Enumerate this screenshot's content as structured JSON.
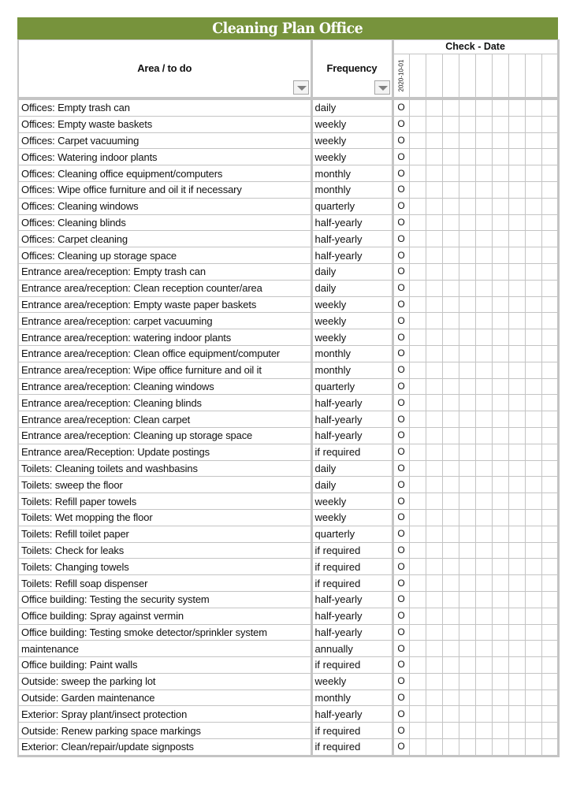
{
  "title": "Cleaning Plan Office",
  "headers": {
    "area": "Area / to do",
    "frequency": "Frequency",
    "check_group": "Check - Date",
    "check_dates": [
      "2020-10-01",
      "",
      "",
      "",
      "",
      "",
      "",
      "",
      "",
      ""
    ]
  },
  "filter_icon": "dropdown-arrow",
  "colors": {
    "title_bg": "#77933c",
    "title_text": "#ffffff",
    "grid": "#c4c4c4"
  },
  "check_mark": "O",
  "rows": [
    {
      "area": "Offices: Empty trash can",
      "frequency": "daily",
      "checks": [
        "O",
        "",
        "",
        "",
        "",
        "",
        "",
        "",
        "",
        ""
      ]
    },
    {
      "area": "Offices: Empty waste baskets",
      "frequency": "weekly",
      "checks": [
        "O",
        "",
        "",
        "",
        "",
        "",
        "",
        "",
        "",
        ""
      ]
    },
    {
      "area": "Offices: Carpet vacuuming",
      "frequency": "weekly",
      "checks": [
        "O",
        "",
        "",
        "",
        "",
        "",
        "",
        "",
        "",
        ""
      ]
    },
    {
      "area": "Offices: Watering indoor plants",
      "frequency": "weekly",
      "checks": [
        "O",
        "",
        "",
        "",
        "",
        "",
        "",
        "",
        "",
        ""
      ]
    },
    {
      "area": "Offices: Cleaning office equipment/computers",
      "frequency": "monthly",
      "checks": [
        "O",
        "",
        "",
        "",
        "",
        "",
        "",
        "",
        "",
        ""
      ]
    },
    {
      "area": "Offices: Wipe office furniture and oil it if necessary",
      "frequency": "monthly",
      "checks": [
        "O",
        "",
        "",
        "",
        "",
        "",
        "",
        "",
        "",
        ""
      ]
    },
    {
      "area": "Offices: Cleaning windows",
      "frequency": "quarterly",
      "checks": [
        "O",
        "",
        "",
        "",
        "",
        "",
        "",
        "",
        "",
        ""
      ]
    },
    {
      "area": "Offices: Cleaning blinds",
      "frequency": "half-yearly",
      "checks": [
        "O",
        "",
        "",
        "",
        "",
        "",
        "",
        "",
        "",
        ""
      ]
    },
    {
      "area": "Offices: Carpet cleaning",
      "frequency": "half-yearly",
      "checks": [
        "O",
        "",
        "",
        "",
        "",
        "",
        "",
        "",
        "",
        ""
      ]
    },
    {
      "area": "Offices: Cleaning up storage space",
      "frequency": "half-yearly",
      "checks": [
        "O",
        "",
        "",
        "",
        "",
        "",
        "",
        "",
        "",
        ""
      ]
    },
    {
      "area": "Entrance area/reception: Empty trash can",
      "frequency": "daily",
      "checks": [
        "O",
        "",
        "",
        "",
        "",
        "",
        "",
        "",
        "",
        ""
      ]
    },
    {
      "area": "Entrance area/reception: Clean reception counter/area",
      "frequency": "daily",
      "checks": [
        "O",
        "",
        "",
        "",
        "",
        "",
        "",
        "",
        "",
        ""
      ]
    },
    {
      "area": "Entrance area/reception: Empty waste paper baskets",
      "frequency": "weekly",
      "checks": [
        "O",
        "",
        "",
        "",
        "",
        "",
        "",
        "",
        "",
        ""
      ]
    },
    {
      "area": "Entrance area/reception: carpet vacuuming",
      "frequency": "weekly",
      "checks": [
        "O",
        "",
        "",
        "",
        "",
        "",
        "",
        "",
        "",
        ""
      ]
    },
    {
      "area": "Entrance area/reception: watering indoor plants",
      "frequency": "weekly",
      "checks": [
        "O",
        "",
        "",
        "",
        "",
        "",
        "",
        "",
        "",
        ""
      ]
    },
    {
      "area": "Entrance area/reception: Clean office equipment/computer",
      "frequency": "monthly",
      "checks": [
        "O",
        "",
        "",
        "",
        "",
        "",
        "",
        "",
        "",
        ""
      ]
    },
    {
      "area": "Entrance area/reception: Wipe office furniture and oil it",
      "frequency": "monthly",
      "checks": [
        "O",
        "",
        "",
        "",
        "",
        "",
        "",
        "",
        "",
        ""
      ]
    },
    {
      "area": "Entrance area/reception: Cleaning windows",
      "frequency": "quarterly",
      "checks": [
        "O",
        "",
        "",
        "",
        "",
        "",
        "",
        "",
        "",
        ""
      ]
    },
    {
      "area": "Entrance area/reception: Cleaning blinds",
      "frequency": "half-yearly",
      "checks": [
        "O",
        "",
        "",
        "",
        "",
        "",
        "",
        "",
        "",
        ""
      ]
    },
    {
      "area": "Entrance area/reception: Clean carpet",
      "frequency": "half-yearly",
      "checks": [
        "O",
        "",
        "",
        "",
        "",
        "",
        "",
        "",
        "",
        ""
      ]
    },
    {
      "area": "Entrance area/reception: Cleaning up storage space",
      "frequency": "half-yearly",
      "checks": [
        "O",
        "",
        "",
        "",
        "",
        "",
        "",
        "",
        "",
        ""
      ]
    },
    {
      "area": "Entrance area/Reception: Update postings",
      "frequency": "if required",
      "checks": [
        "O",
        "",
        "",
        "",
        "",
        "",
        "",
        "",
        "",
        ""
      ]
    },
    {
      "area": "Toilets: Cleaning toilets and washbasins",
      "frequency": "daily",
      "checks": [
        "O",
        "",
        "",
        "",
        "",
        "",
        "",
        "",
        "",
        ""
      ]
    },
    {
      "area": "Toilets: sweep the floor",
      "frequency": "daily",
      "checks": [
        "O",
        "",
        "",
        "",
        "",
        "",
        "",
        "",
        "",
        ""
      ]
    },
    {
      "area": "Toilets: Refill paper towels",
      "frequency": "weekly",
      "checks": [
        "O",
        "",
        "",
        "",
        "",
        "",
        "",
        "",
        "",
        ""
      ]
    },
    {
      "area": "Toilets: Wet mopping the floor",
      "frequency": "weekly",
      "checks": [
        "O",
        "",
        "",
        "",
        "",
        "",
        "",
        "",
        "",
        ""
      ]
    },
    {
      "area": "Toilets: Refill toilet paper",
      "frequency": "quarterly",
      "checks": [
        "O",
        "",
        "",
        "",
        "",
        "",
        "",
        "",
        "",
        ""
      ]
    },
    {
      "area": "Toilets: Check for leaks",
      "frequency": "if required",
      "checks": [
        "O",
        "",
        "",
        "",
        "",
        "",
        "",
        "",
        "",
        ""
      ]
    },
    {
      "area": "Toilets: Changing towels",
      "frequency": "if required",
      "checks": [
        "O",
        "",
        "",
        "",
        "",
        "",
        "",
        "",
        "",
        ""
      ]
    },
    {
      "area": "Toilets: Refill soap dispenser",
      "frequency": "if required",
      "checks": [
        "O",
        "",
        "",
        "",
        "",
        "",
        "",
        "",
        "",
        ""
      ]
    },
    {
      "area": "Office building: Testing the security system",
      "frequency": "half-yearly",
      "checks": [
        "O",
        "",
        "",
        "",
        "",
        "",
        "",
        "",
        "",
        ""
      ]
    },
    {
      "area": "Office building: Spray against vermin",
      "frequency": "half-yearly",
      "checks": [
        "O",
        "",
        "",
        "",
        "",
        "",
        "",
        "",
        "",
        ""
      ]
    },
    {
      "area": "Office building: Testing smoke detector/sprinkler system",
      "frequency": "half-yearly",
      "checks": [
        "O",
        "",
        "",
        "",
        "",
        "",
        "",
        "",
        "",
        ""
      ]
    },
    {
      "area": "maintenance",
      "frequency": "annually",
      "checks": [
        "O",
        "",
        "",
        "",
        "",
        "",
        "",
        "",
        "",
        ""
      ]
    },
    {
      "area": "Office building: Paint walls",
      "frequency": "if required",
      "checks": [
        "O",
        "",
        "",
        "",
        "",
        "",
        "",
        "",
        "",
        ""
      ]
    },
    {
      "area": "Outside: sweep the parking lot",
      "frequency": "weekly",
      "checks": [
        "O",
        "",
        "",
        "",
        "",
        "",
        "",
        "",
        "",
        ""
      ]
    },
    {
      "area": "Outside: Garden maintenance",
      "frequency": "monthly",
      "checks": [
        "O",
        "",
        "",
        "",
        "",
        "",
        "",
        "",
        "",
        ""
      ]
    },
    {
      "area": "Exterior: Spray plant/insect protection",
      "frequency": "half-yearly",
      "checks": [
        "O",
        "",
        "",
        "",
        "",
        "",
        "",
        "",
        "",
        ""
      ]
    },
    {
      "area": "Outside: Renew parking space markings",
      "frequency": "if required",
      "checks": [
        "O",
        "",
        "",
        "",
        "",
        "",
        "",
        "",
        "",
        ""
      ]
    },
    {
      "area": "Exterior: Clean/repair/update signposts",
      "frequency": "if required",
      "checks": [
        "O",
        "",
        "",
        "",
        "",
        "",
        "",
        "",
        "",
        ""
      ]
    }
  ]
}
